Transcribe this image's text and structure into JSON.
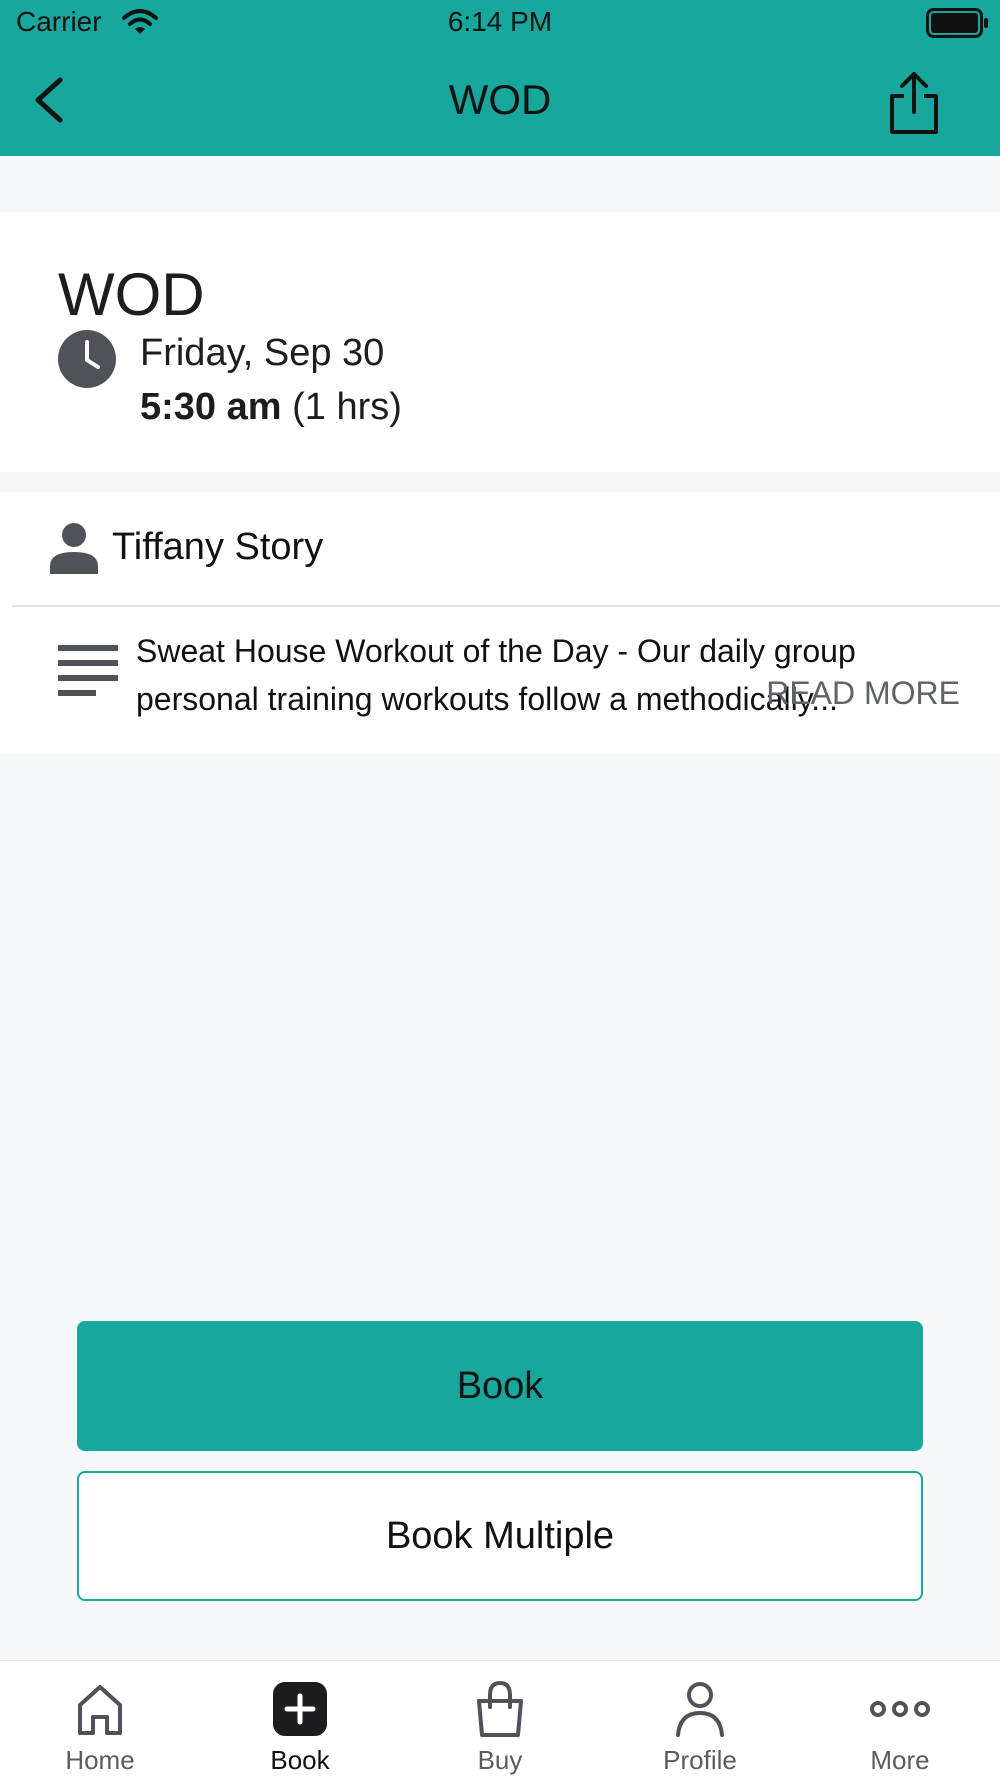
{
  "status_bar": {
    "carrier": "Carrier",
    "time": "6:14 PM"
  },
  "nav": {
    "title": "WOD"
  },
  "class": {
    "title": "WOD",
    "date": "Friday, Sep 30",
    "time_bold": "5:30 am",
    "duration": " (1 hrs)"
  },
  "instructor": {
    "name": "Tiffany Story"
  },
  "description": {
    "text": "Sweat House Workout of the Day - Our daily group personal training workouts follow a methodically...",
    "read_more": "READ MORE"
  },
  "actions": {
    "book": "Book",
    "book_multiple": "Book Multiple"
  },
  "tabs": [
    {
      "label": "Home",
      "icon": "home-icon"
    },
    {
      "label": "Book",
      "icon": "plus-icon"
    },
    {
      "label": "Buy",
      "icon": "bag-icon"
    },
    {
      "label": "Profile",
      "icon": "profile-icon"
    },
    {
      "label": "More",
      "icon": "more-icon"
    }
  ],
  "colors": {
    "accent": "#16a89c",
    "icon_gray": "#505259"
  }
}
